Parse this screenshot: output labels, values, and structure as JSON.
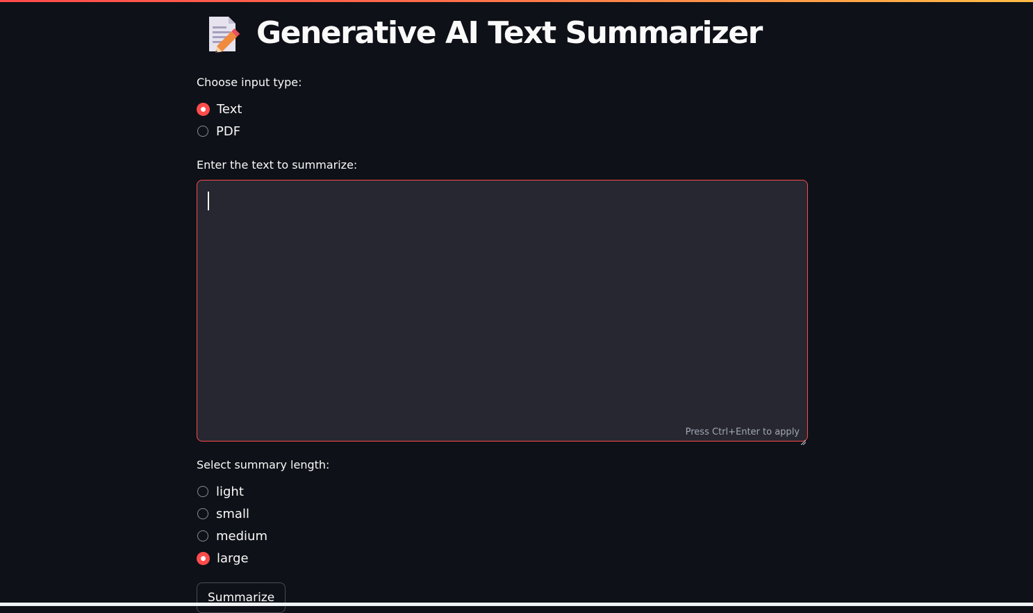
{
  "header": {
    "title": "Generative AI Text Summarizer",
    "icon": "memo-icon"
  },
  "input_type": {
    "label": "Choose input type:",
    "options": [
      {
        "label": "Text",
        "checked": true
      },
      {
        "label": "PDF",
        "checked": false
      }
    ]
  },
  "text_input": {
    "label": "Enter the text to summarize:",
    "value": "",
    "hint": "Press Ctrl+Enter to apply"
  },
  "summary_length": {
    "label": "Select summary length:",
    "options": [
      {
        "label": "light",
        "checked": false
      },
      {
        "label": "small",
        "checked": false
      },
      {
        "label": "medium",
        "checked": false
      },
      {
        "label": "large",
        "checked": true
      }
    ]
  },
  "actions": {
    "summarize_label": "Summarize"
  },
  "colors": {
    "background": "#0e1117",
    "accent": "#ff4b4b",
    "input_background": "#262730",
    "text": "#fafafa"
  }
}
